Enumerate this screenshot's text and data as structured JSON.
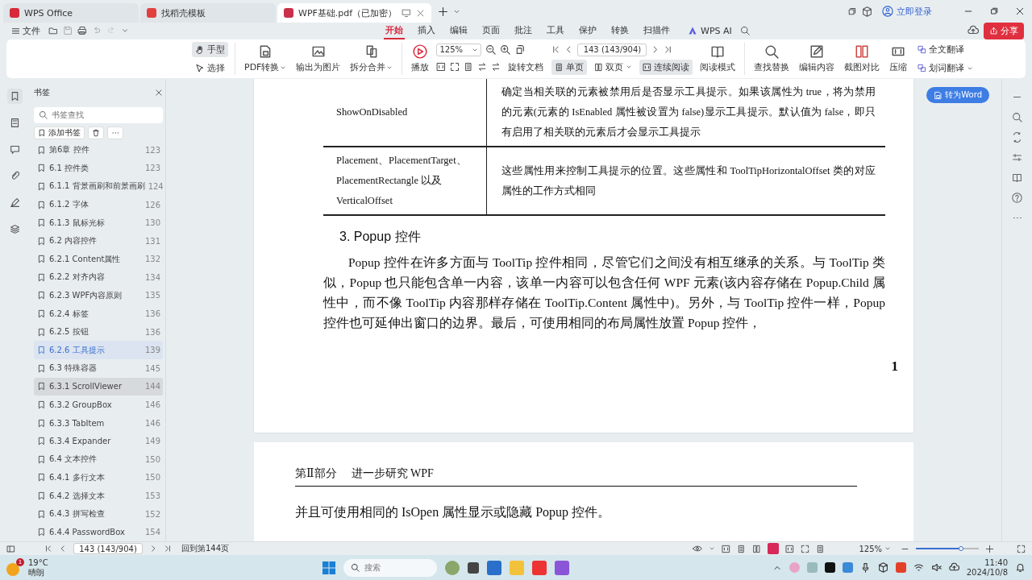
{
  "title_bar": {
    "tabs": [
      {
        "label": "WPS Office",
        "selected": false
      },
      {
        "label": "找稻壳模板",
        "selected": false
      },
      {
        "label": "WPF基础.pdf（已加密）",
        "selected": true
      }
    ],
    "login": "立即登录"
  },
  "menu_bar": {
    "file": "文件",
    "tabs": [
      {
        "label": "开始",
        "selected": true
      },
      {
        "label": "插入",
        "selected": false
      },
      {
        "label": "编辑",
        "selected": false
      },
      {
        "label": "页面",
        "selected": false
      },
      {
        "label": "批注",
        "selected": false
      },
      {
        "label": "工具",
        "selected": false
      },
      {
        "label": "保护",
        "selected": false
      },
      {
        "label": "转换",
        "selected": false
      },
      {
        "label": "扫描件",
        "selected": false
      }
    ],
    "ai": "WPS AI",
    "share": "分享"
  },
  "toolbar": {
    "modes": [
      {
        "label": "手型",
        "selected": true
      },
      {
        "label": "选择",
        "selected": false
      }
    ],
    "convert": [
      {
        "label": "PDF转换",
        "dropdown": true
      },
      {
        "label": "输出为图片",
        "dropdown": false
      },
      {
        "label": "拆分合并",
        "dropdown": true
      }
    ],
    "play": "播放",
    "zoom": "125%",
    "rotate": "旋转文档",
    "page_field": "143 (143/904)",
    "views": [
      {
        "label": "单页",
        "selected": true,
        "dropdown": false
      },
      {
        "label": "双页",
        "selected": false,
        "dropdown": true
      },
      {
        "label": "连续阅读",
        "selected": true,
        "dropdown": false
      }
    ],
    "read_mode": "阅读模式",
    "tools": [
      "查找替换",
      "编辑内容",
      "截图对比",
      "压缩"
    ],
    "translate": [
      {
        "label": "全文翻译",
        "dropdown": false
      },
      {
        "label": "划词翻译",
        "dropdown": true
      }
    ]
  },
  "sidebar": {
    "title": "书签",
    "search_placeholder": "书签查找",
    "add": "添加书签",
    "items": [
      {
        "label": "第6章 控件",
        "page": "123",
        "selected": false,
        "hovered": false
      },
      {
        "label": "6.1 控件类",
        "page": "123",
        "selected": false,
        "hovered": false
      },
      {
        "label": "6.1.1 背景画刷和前景画刷",
        "page": "124",
        "selected": false,
        "hovered": false
      },
      {
        "label": "6.1.2 字体",
        "page": "126",
        "selected": false,
        "hovered": false
      },
      {
        "label": "6.1.3 鼠标光标",
        "page": "130",
        "selected": false,
        "hovered": false
      },
      {
        "label": "6.2 内容控件",
        "page": "131",
        "selected": false,
        "hovered": false
      },
      {
        "label": "6.2.1 Content属性",
        "page": "132",
        "selected": false,
        "hovered": false
      },
      {
        "label": "6.2.2 对齐内容",
        "page": "134",
        "selected": false,
        "hovered": false
      },
      {
        "label": "6.2.3 WPF内容原则",
        "page": "135",
        "selected": false,
        "hovered": false
      },
      {
        "label": "6.2.4 标签",
        "page": "136",
        "selected": false,
        "hovered": false
      },
      {
        "label": "6.2.5 按钮",
        "page": "136",
        "selected": false,
        "hovered": false
      },
      {
        "label": "6.2.6 工具提示",
        "page": "139",
        "selected": true,
        "hovered": false
      },
      {
        "label": "6.3 特殊容器",
        "page": "145",
        "selected": false,
        "hovered": false
      },
      {
        "label": "6.3.1 ScrollViewer",
        "page": "144",
        "selected": false,
        "hovered": true
      },
      {
        "label": "6.3.2 GroupBox",
        "page": "146",
        "selected": false,
        "hovered": false
      },
      {
        "label": "6.3.3 TabItem",
        "page": "146",
        "selected": false,
        "hovered": false
      },
      {
        "label": "6.3.4 Expander",
        "page": "149",
        "selected": false,
        "hovered": false
      },
      {
        "label": "6.4 文本控件",
        "page": "150",
        "selected": false,
        "hovered": false
      },
      {
        "label": "6.4.1 多行文本",
        "page": "150",
        "selected": false,
        "hovered": false
      },
      {
        "label": "6.4.2 选择文本",
        "page": "153",
        "selected": false,
        "hovered": false
      },
      {
        "label": "6.4.3 拼写检查",
        "page": "152",
        "selected": false,
        "hovered": false
      },
      {
        "label": "6.4.4 PasswordBox",
        "page": "154",
        "selected": false,
        "hovered": false
      }
    ]
  },
  "document": {
    "table": [
      {
        "property": "ShowOnDisabled",
        "description": "确定当相关联的元素被禁用后是否显示工具提示。如果该属性为 true，将为禁用的元素(元素的 IsEnabled 属性被设置为 false)显示工具提示。默认值为 false，即只有启用了相关联的元素后才会显示工具提示"
      },
      {
        "property": "Placement、PlacementTarget、PlacementRectangle 以及 VerticalOffset",
        "description": "这些属性用来控制工具提示的位置。这些属性和 ToolTipHorizontalOffset 类的对应属性的工作方式相同"
      }
    ],
    "heading": "3. Popup 控件",
    "paragraph": "Popup 控件在许多方面与 ToolTip 控件相同，尽管它们之间没有相互继承的关系。与 ToolTip 类似，Popup 也只能包含单一内容，该单一内容可以包含任何 WPF 元素(该内容存储在 Popup.Child 属性中，而不像 ToolTip 内容那样存储在 ToolTip.Content 属性中)。另外，与 ToolTip 控件一样，Popup 控件也可延伸出窗口的边界。最后，可使用相同的布局属性放置 Popup 控件，",
    "page_number": "1",
    "next_page": {
      "part": "第Ⅱ部分",
      "title": "进一步研究 WPF",
      "text": "并且可使用相同的 IsOpen 属性显示或隐藏 Popup 控件。"
    }
  },
  "convert_button": "转为Word",
  "status_bar": {
    "page_field": "143 (143/904)",
    "back": "回到第144页",
    "zoom": "125%",
    "level": 0.72
  },
  "taskbar": {
    "weather": {
      "badge": "1",
      "temperature": "19°C",
      "condition": "晴朗"
    },
    "search_placeholder": "搜索",
    "time": "11:40",
    "date": "2024/10/8"
  }
}
